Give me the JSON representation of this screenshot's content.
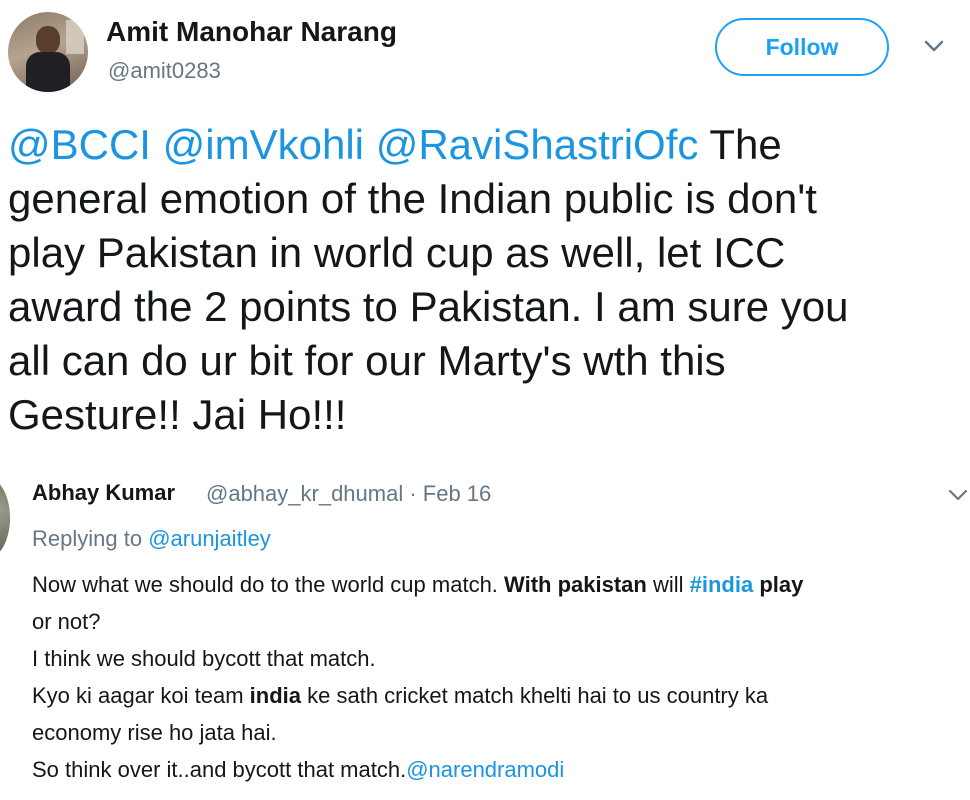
{
  "tweet": {
    "author": {
      "display_name": "Amit Manohar Narang",
      "handle": "@amit0283"
    },
    "follow_label": "Follow",
    "mentions": [
      "@BCCI",
      "@imVkohli",
      "@RaviShastriOfc"
    ],
    "text_line1": " The",
    "text_line2": "general emotion of the Indian public is don't",
    "text_line3": "play Pakistan in world cup as well, let ICC",
    "text_line4": "award the 2 points to Pakistan. I am sure you",
    "text_line5": "all can do ur bit for our Marty's wth this",
    "text_line6": "Gesture!! Jai Ho!!!"
  },
  "reply": {
    "author_name": "Abhay Kumar",
    "meta": "@abhay_kr_dhumal · Feb 16",
    "replying_prefix": "Replying to ",
    "replying_handle": "@arunjaitley",
    "l1_a": "Now what we should do to the world cup match. ",
    "l1_b": "With pakistan",
    "l1_c": " will ",
    "l1_hashtag": "#india",
    "l1_d": " play",
    "l2": "or not?",
    "l3": "I think we should bycott that match.",
    "l4_a": "Kyo ki aagar koi team ",
    "l4_b": "india",
    "l4_c": " ke sath cricket match khelti hai to us country ka",
    "l5": "economy rise ho jata hai.",
    "l6_a": "So think over it..and bycott that match.",
    "l6_mention": "@narendramodi"
  },
  "colors": {
    "link_blue": "#1b95e0",
    "follow_blue": "#1da1f2",
    "muted_gray": "#657786",
    "text": "#14171a"
  },
  "icons": {
    "main_caret": "chevron-down-icon",
    "reply_caret": "chevron-down-icon"
  }
}
